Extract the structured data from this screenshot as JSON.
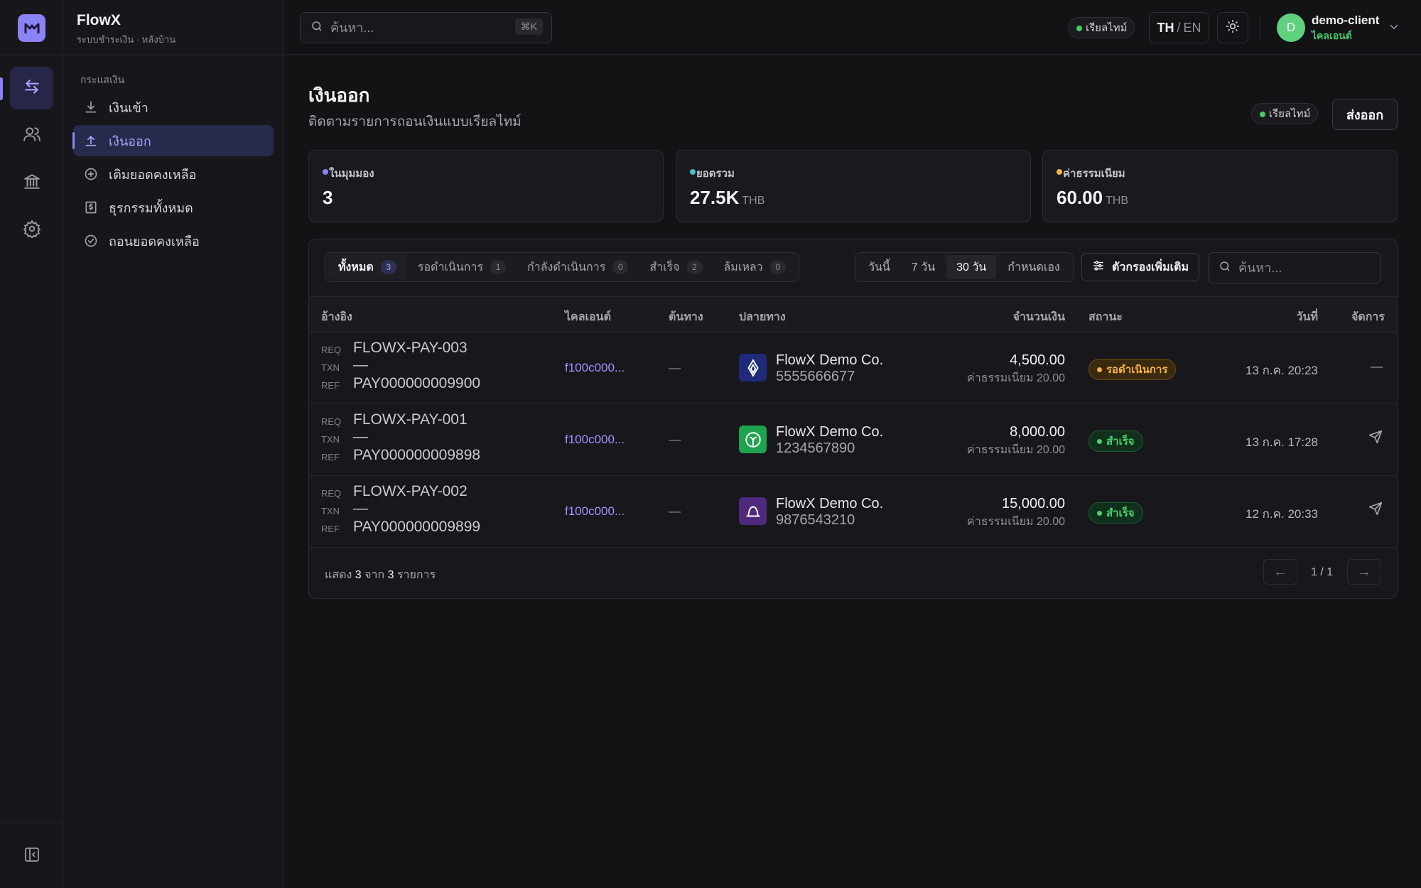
{
  "app": {
    "name": "FlowX",
    "subtitle": "ระบบชำระเงิน · หลังบ้าน"
  },
  "rail": {
    "items": [
      {
        "icon": "transfer-arrows-icon",
        "active": true
      },
      {
        "icon": "users-icon",
        "active": false
      },
      {
        "icon": "bank-icon",
        "active": false
      },
      {
        "icon": "gear-icon",
        "active": false
      }
    ],
    "collapse_icon": "sidebar-collapse-icon"
  },
  "sidebar": {
    "section": "กระแสเงิน",
    "items": [
      {
        "label": "เงินเข้า",
        "icon": "download-icon",
        "active": false
      },
      {
        "label": "เงินออก",
        "icon": "upload-icon",
        "active": true
      },
      {
        "label": "เติมยอดคงเหลือ",
        "icon": "plus-circle-icon",
        "active": false
      },
      {
        "label": "ธุรกรรมทั้งหมด",
        "icon": "receipt-icon",
        "active": false
      },
      {
        "label": "ถอนยอดคงเหลือ",
        "icon": "check-circle-icon",
        "active": false
      }
    ]
  },
  "topbar": {
    "search_placeholder": "ค้นหา...",
    "search_shortcut": "⌘K",
    "realtime_label": "เรียลไทม์",
    "lang_active": "TH",
    "lang_sep": "/",
    "lang_other": "EN",
    "theme_icon": "sun-icon",
    "user": {
      "initial": "D",
      "name": "demo-client",
      "role": "ไคลเอนต์"
    }
  },
  "page": {
    "title": "เงินออก",
    "subtitle": "ติดตามรายการถอนเงินแบบเรียลไทม์",
    "realtime_label": "เรียลไทม์",
    "export_label": "ส่งออก"
  },
  "stats": [
    {
      "label": "ในมุมมอง",
      "value": "3",
      "unit": "",
      "dot": "#8b83f5"
    },
    {
      "label": "ยอดรวม",
      "value": "27.5K",
      "unit": "THB",
      "dot": "#3ec6c6"
    },
    {
      "label": "ค่าธรรมเนียม",
      "value": "60.00",
      "unit": "THB",
      "dot": "#f5b441"
    }
  ],
  "tabs": [
    {
      "label": "ทั้งหมด",
      "count": "3",
      "active": true
    },
    {
      "label": "รอดำเนินการ",
      "count": "1",
      "active": false
    },
    {
      "label": "กำลังดำเนินการ",
      "count": "0",
      "active": false
    },
    {
      "label": "สำเร็จ",
      "count": "2",
      "active": false
    },
    {
      "label": "ล้มเหลว",
      "count": "0",
      "active": false
    }
  ],
  "ranges": [
    {
      "label": "วันนี้",
      "active": false
    },
    {
      "label": "7 วัน",
      "active": false
    },
    {
      "label": "30 วัน",
      "active": true
    },
    {
      "label": "กำหนดเอง",
      "active": false
    }
  ],
  "filter_label": "ตัวกรองเพิ่มเติม",
  "table_search_placeholder": "ค้นหา...",
  "columns": {
    "reference": "อ้างอิง",
    "client": "ไคลเอนต์",
    "source": "ต้นทาง",
    "destination": "ปลายทาง",
    "amount": "จำนวนเงิน",
    "status": "สถานะ",
    "date": "วันที่",
    "actions": "จัดการ"
  },
  "ref_labels": {
    "req": "REQ",
    "txn": "TXN",
    "ref": "REF"
  },
  "rows": [
    {
      "req": "FLOWX-PAY-003",
      "txn": "—",
      "ref": "PAY000000009900",
      "client": "f100c000...",
      "source": "—",
      "dest_name": "FlowX Demo Co.",
      "dest_account": "5555666677",
      "bank_icon": "krungsri-bank-icon",
      "bank_color": "#1f2a7a",
      "amount": "4,500.00",
      "fee": "ค่าธรรมเนียม 20.00",
      "status": "รอดำเนินการ",
      "status_kind": "pending",
      "date": "13 ก.ค. 20:23",
      "action": "—"
    },
    {
      "req": "FLOWX-PAY-001",
      "txn": "—",
      "ref": "PAY000000009898",
      "client": "f100c000...",
      "source": "—",
      "dest_name": "FlowX Demo Co.",
      "dest_account": "1234567890",
      "bank_icon": "kbank-leaf-icon",
      "bank_color": "#1ea44d",
      "amount": "8,000.00",
      "fee": "ค่าธรรมเนียม 20.00",
      "status": "สำเร็จ",
      "status_kind": "success",
      "date": "13 ก.ค. 17:28",
      "action": "send-icon"
    },
    {
      "req": "FLOWX-PAY-002",
      "txn": "—",
      "ref": "PAY000000009899",
      "client": "f100c000...",
      "source": "—",
      "dest_name": "FlowX Demo Co.",
      "dest_account": "9876543210",
      "bank_icon": "scb-bell-icon",
      "bank_color": "#4d2a7e",
      "amount": "15,000.00",
      "fee": "ค่าธรรมเนียม 20.00",
      "status": "สำเร็จ",
      "status_kind": "success",
      "date": "12 ก.ค. 20:33",
      "action": "send-icon"
    }
  ],
  "footer": {
    "shown_prefix": "แสดง",
    "shown": "3",
    "of_word": "จาก",
    "total": "3",
    "items_word": "รายการ",
    "page_info": "1 / 1",
    "prev": "←",
    "next": "→"
  }
}
